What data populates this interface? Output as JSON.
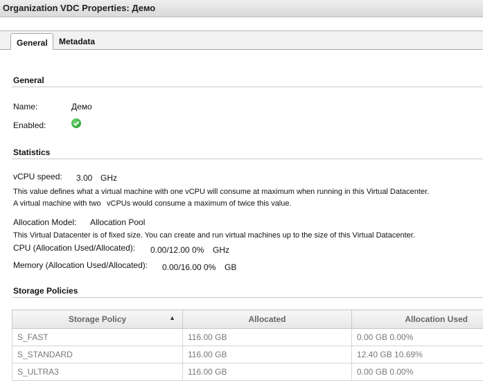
{
  "window": {
    "title": "Organization VDC Properties: Демо"
  },
  "tabs": [
    {
      "label": "General",
      "active": true
    },
    {
      "label": "Metadata",
      "active": false
    }
  ],
  "general": {
    "heading": "General",
    "name_label": "Name:",
    "name_value": "Демо",
    "enabled_label": "Enabled:",
    "enabled_icon": "check-circle-icon"
  },
  "statistics": {
    "heading": "Statistics",
    "vcpu_label": "vCPU speed:",
    "vcpu_value": "3.00",
    "vcpu_unit": "GHz",
    "vcpu_note_line1": "This value defines what a virtual machine with one vCPU will consume at maximum when running in this Virtual Datacenter.",
    "vcpu_note_line2a": "A virtual machine with two",
    "vcpu_note_line2b": "vCPUs would consume a maximum of twice this value.",
    "allocation_model_label": "Allocation Model:",
    "allocation_model_value": "Allocation Pool",
    "allocation_note": "This Virtual Datacenter is of fixed size. You can create and run virtual machines up to the size of this Virtual Datacenter.",
    "cpu_label": "CPU (Allocation Used/Allocated):",
    "cpu_value": "0.00/12.00 0%",
    "cpu_unit": "GHz",
    "memory_label": "Memory (Allocation Used/Allocated):",
    "memory_value": "0.00/16.00 0%",
    "memory_unit": "GB"
  },
  "storage": {
    "heading": "Storage Policies",
    "columns": [
      "Storage Policy",
      "Allocated",
      "Allocation Used"
    ],
    "sort_indicator": "▲",
    "rows": [
      [
        "S_FAST",
        "116.00 GB",
        "0.00 GB 0.00%"
      ],
      [
        "S_STANDARD",
        "116.00 GB",
        "12.40 GB 10.69%"
      ],
      [
        "S_ULTRA3",
        "116.00 GB",
        "0.00 GB 0.00%"
      ]
    ]
  },
  "colors": {
    "enabled_green": "#1c9a2c",
    "header_gray": "#e6e6e6"
  }
}
